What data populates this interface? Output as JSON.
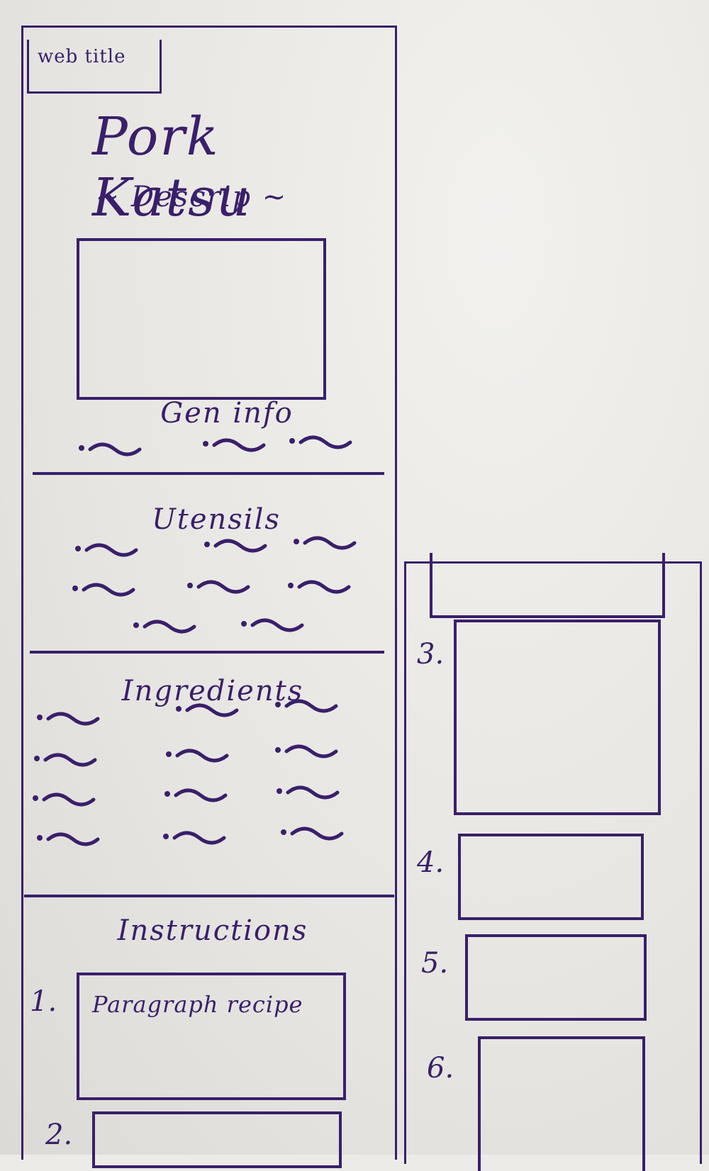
{
  "page": {
    "tab_label": "web title",
    "title": "Pork Katsu",
    "description": "~ Descrip ~"
  },
  "sections": {
    "gen_info": "Gen info",
    "utensils": "Utensils",
    "ingredients": "Ingredients",
    "instructions": "Instructions"
  },
  "steps": [
    {
      "number": "1.",
      "text": "Paragraph recipe"
    },
    {
      "number": "2.",
      "text": ""
    },
    {
      "number": "3.",
      "text": ""
    },
    {
      "number": "4.",
      "text": ""
    },
    {
      "number": "5.",
      "text": ""
    },
    {
      "number": "6.",
      "text": ""
    }
  ],
  "colors": {
    "ink": "#3a1f6b",
    "paper": "#ecebe8"
  },
  "bullet_counts": {
    "gen_info": 3,
    "utensils": 8,
    "ingredients": 12
  }
}
